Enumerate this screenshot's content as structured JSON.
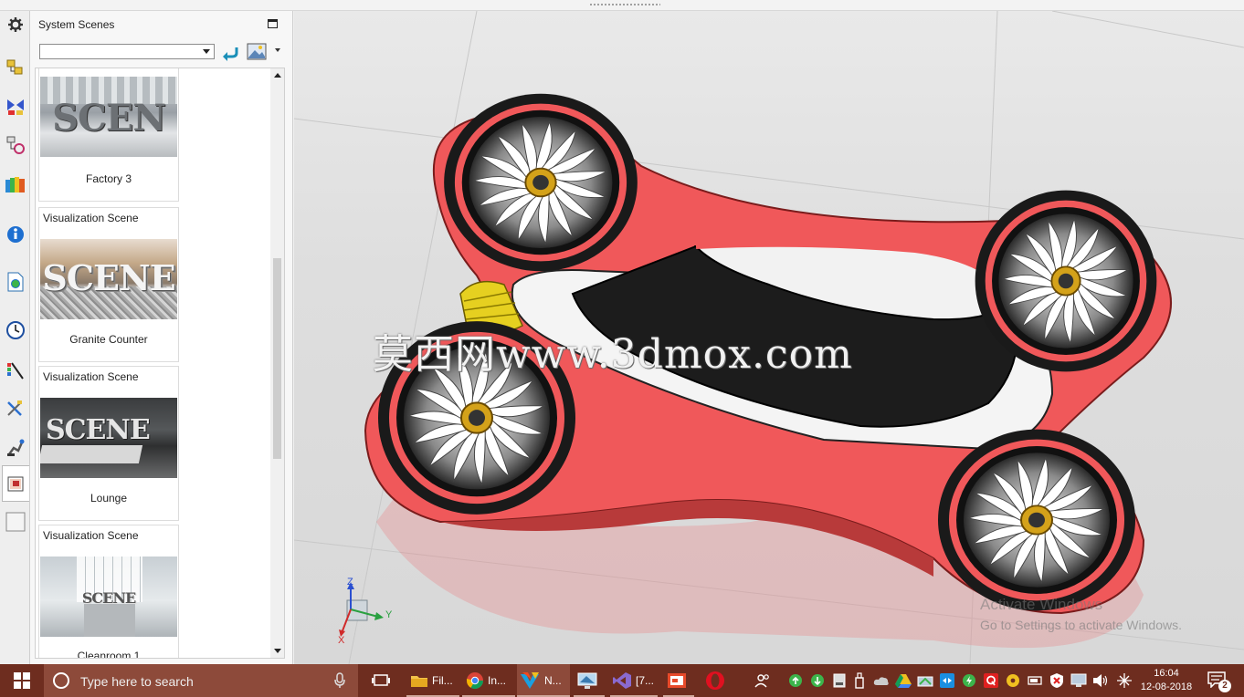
{
  "panel": {
    "title": "System Scenes",
    "select_value": ""
  },
  "scenes": [
    {
      "type": "",
      "name": "Factory 3",
      "thumb_text": "SCEN"
    },
    {
      "type": "Visualization Scene",
      "name": "Granite Counter",
      "thumb_text": "SCENE"
    },
    {
      "type": "Visualization Scene",
      "name": "Lounge",
      "thumb_text": "SCENE"
    },
    {
      "type": "Visualization Scene",
      "name": "Cleanroom 1",
      "thumb_text": "SCENE"
    }
  ],
  "viewport": {
    "watermark": "莫西网www.3dmox.com",
    "activate_title": "Activate Windows",
    "activate_sub": "Go to Settings to activate Windows.",
    "axes": {
      "z": "Z",
      "y": "Y",
      "x": "X"
    }
  },
  "taskbar": {
    "search_placeholder": "Type here to search",
    "apps": [
      {
        "label": "Fil...",
        "icon": "file-explorer-icon"
      },
      {
        "label": "In...",
        "icon": "chrome-icon"
      },
      {
        "label": "N...",
        "icon": "nx-icon"
      },
      {
        "label": "",
        "icon": "monitor-app-icon"
      },
      {
        "label": "[7...",
        "icon": "visual-studio-icon"
      },
      {
        "label": "",
        "icon": "presentation-icon"
      },
      {
        "label": "",
        "icon": "opera-icon"
      }
    ],
    "time": "16:04",
    "date": "12-08-2018",
    "notification_count": "2"
  },
  "colors": {
    "taskbar": "#6e2d1f",
    "drone_red": "#f0585a",
    "accent_gold": "#d4a21a"
  }
}
